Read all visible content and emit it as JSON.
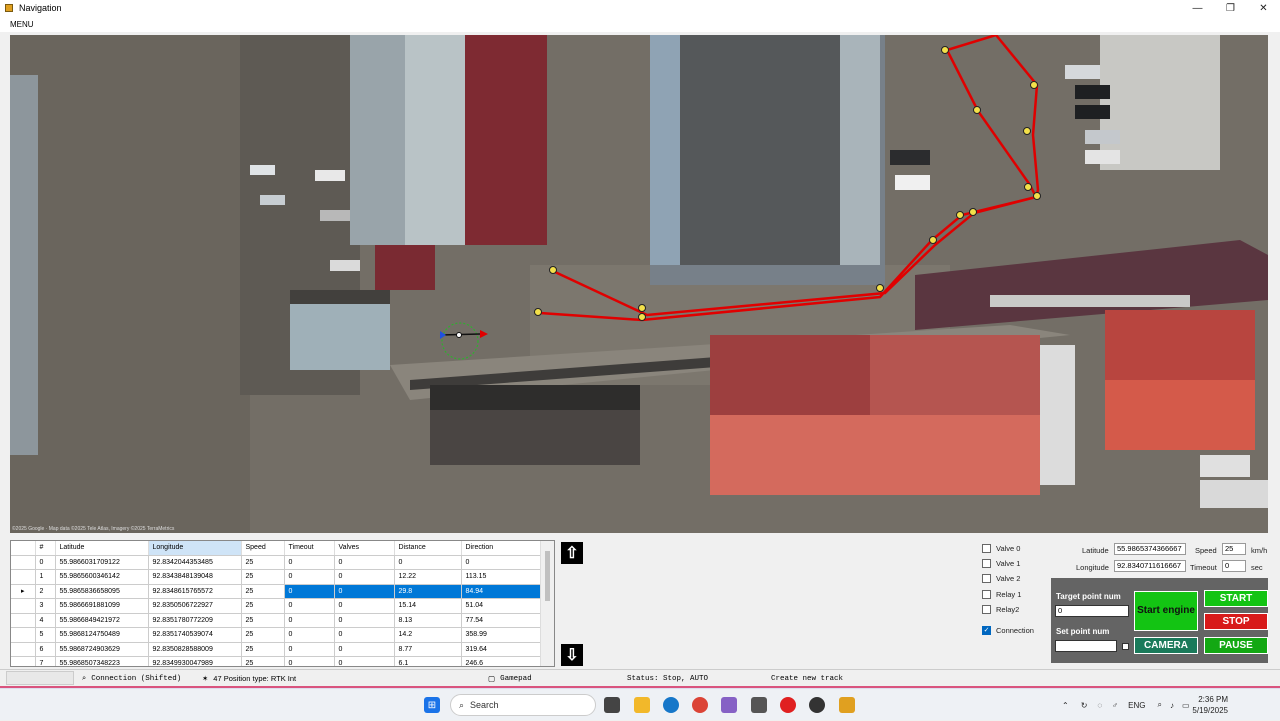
{
  "window": {
    "title": "Navigation"
  },
  "menu": {
    "label": "MENU"
  },
  "map": {
    "attribution": "©2025 Google · Map data ©2025 Tele Atlas, Imagery ©2025 TerraMetrics"
  },
  "grid": {
    "columns": [
      "#",
      "Latitude",
      "Longitude",
      "Speed",
      "Timeout",
      "Valves",
      "Distance",
      "Direction"
    ],
    "selected_row": 2,
    "rows": [
      [
        "0",
        "55.9866031709122",
        "92.8342044353485",
        "25",
        "0",
        "0",
        "0",
        "0"
      ],
      [
        "1",
        "55.9865600346142",
        "92.8343848139048",
        "25",
        "0",
        "0",
        "12.22",
        "113.15"
      ],
      [
        "2",
        "55.9865836658095",
        "92.8348615765572",
        "25",
        "0",
        "0",
        "29.8",
        "84.94"
      ],
      [
        "3",
        "55.9866691881099",
        "92.8350506722927",
        "25",
        "0",
        "0",
        "15.14",
        "51.04"
      ],
      [
        "4",
        "55.9866849421972",
        "92.8351780772209",
        "25",
        "0",
        "0",
        "8.13",
        "77.54"
      ],
      [
        "5",
        "55.9868124750489",
        "92.8351740539074",
        "25",
        "0",
        "0",
        "14.2",
        "358.99"
      ],
      [
        "6",
        "55.9868724903629",
        "92.8350828588009",
        "25",
        "0",
        "0",
        "8.77",
        "319.64"
      ],
      [
        "7",
        "55.9868507348223",
        "92.8349930047989",
        "25",
        "0",
        "0",
        "6.1",
        "246.6"
      ]
    ]
  },
  "checks": [
    {
      "label": "Valve 0",
      "checked": false
    },
    {
      "label": "Valve 1",
      "checked": false
    },
    {
      "label": "Valve 2",
      "checked": false
    },
    {
      "label": "Relay 1",
      "checked": false
    },
    {
      "label": "Relay2",
      "checked": false
    },
    {
      "label": "Connection",
      "checked": true
    }
  ],
  "position": {
    "latitude_label": "Latitude",
    "latitude": "55.9865374366667",
    "longitude_label": "Longitude",
    "longitude": "92.8340711616667",
    "speed_label": "Speed",
    "speed": "25",
    "speed_unit": "km/h",
    "timeout_label": "Timeout",
    "timeout": "0",
    "timeout_unit": "sec"
  },
  "control": {
    "target_label": "Target point num",
    "target_value": "0",
    "set_label": "Set point num",
    "set_value": "",
    "start_engine": "Start engine",
    "start": "START",
    "stop": "STOP",
    "camera": "CAMERA",
    "pause": "PAUSE",
    "colors": {
      "green": "#13c413",
      "red": "#d81a1a",
      "dark": "#1a7a5a",
      "panel": "#646464"
    }
  },
  "status": {
    "connection": "Connection (Shifted)",
    "position_type": "47 Position type: RTK Int",
    "gamepad": "Gamepad",
    "state": "Status: Stop, AUTO",
    "track": "Create new track"
  },
  "taskbar": {
    "search": "Search",
    "lang": "ENG",
    "time": "2:36 PM",
    "date": "5/19/2025"
  }
}
